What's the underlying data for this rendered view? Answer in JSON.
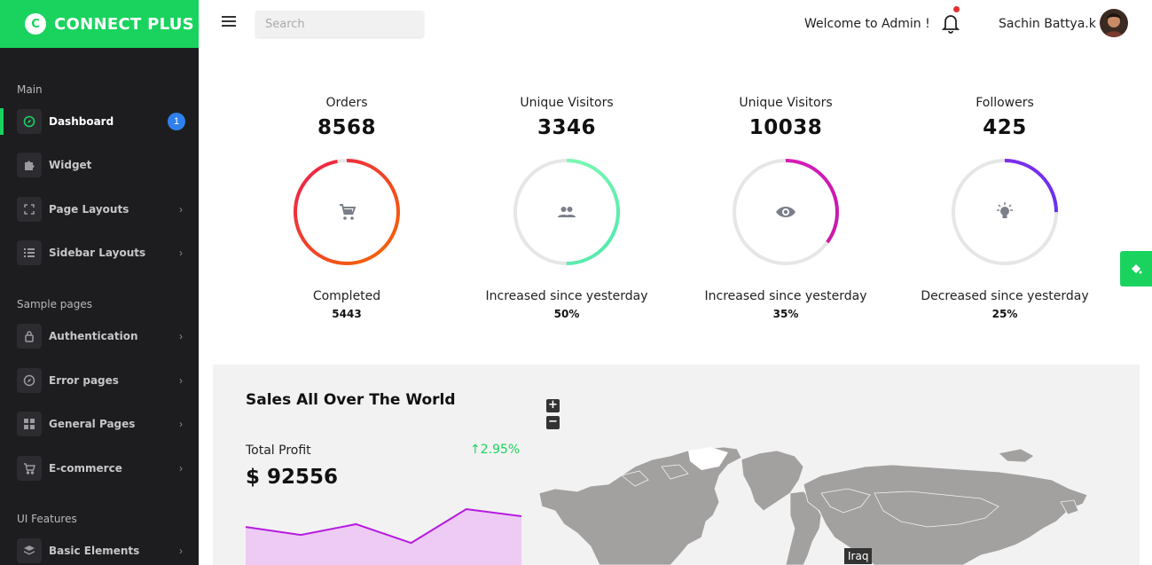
{
  "brand": {
    "logo_letter": "C",
    "name": "CONNECT PLUS",
    "color": "#1ad35e"
  },
  "topbar": {
    "search_placeholder": "Search",
    "welcome": "Welcome to Admin !",
    "username": "Sachin Battya.k"
  },
  "sidebar": {
    "categories": [
      "Main",
      "Sample pages",
      "UI Features"
    ],
    "items": [
      {
        "label": "Dashboard",
        "icon": "compass-icon",
        "badge": "1",
        "active": true
      },
      {
        "label": "Widget",
        "icon": "puzzle-icon"
      },
      {
        "label": "Page Layouts",
        "icon": "expand-icon",
        "chevron": "›"
      },
      {
        "label": "Sidebar Layouts",
        "icon": "list-icon",
        "chevron": "›"
      },
      {
        "label": "Authentication",
        "icon": "lock-icon",
        "chevron": "›"
      },
      {
        "label": "Error pages",
        "icon": "compass-icon",
        "chevron": "›"
      },
      {
        "label": "General Pages",
        "icon": "grid-icon",
        "chevron": "›"
      },
      {
        "label": "E-commerce",
        "icon": "cart-icon",
        "chevron": "›"
      },
      {
        "label": "Basic Elements",
        "icon": "layers-icon",
        "chevron": "›"
      }
    ]
  },
  "stats": [
    {
      "title": "Orders",
      "value": "8568",
      "icon": "cart-icon",
      "progress": 0.97,
      "colors": [
        "#f56a00",
        "#ef1d4f"
      ],
      "sub_label": "Completed",
      "sub_value": "5443"
    },
    {
      "title": "Unique Visitors",
      "value": "3346",
      "icon": "users-icon",
      "progress": 0.5,
      "colors": [
        "#4de8ad",
        "#8cffb6"
      ],
      "sub_label": "Increased since yesterday",
      "sub_value": "50%"
    },
    {
      "title": "Unique Visitors",
      "value": "10038",
      "icon": "eye-icon",
      "progress": 0.35,
      "colors": [
        "#c41aa8",
        "#d91ec0"
      ],
      "sub_label": "Increased since yesterday",
      "sub_value": "35%"
    },
    {
      "title": "Followers",
      "value": "425",
      "icon": "bulb-icon",
      "progress": 0.25,
      "colors": [
        "#5c33f6",
        "#8a2be2"
      ],
      "sub_label": "Decreased since yesterday",
      "sub_value": "25%"
    }
  ],
  "sales": {
    "title": "Sales All Over The World",
    "profit_label": "Total Profit",
    "profit_change": "2.95%",
    "profit_value": "$ 92556",
    "zoom_in": "+",
    "zoom_out": "−",
    "map_tooltip": "Iraq",
    "trend": [
      0.62,
      0.45,
      0.68,
      0.28,
      1.0,
      0.85
    ]
  }
}
